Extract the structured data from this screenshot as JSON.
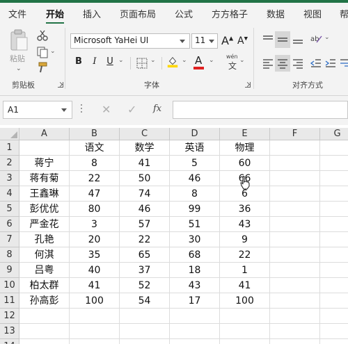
{
  "tabs": [
    "文件",
    "开始",
    "插入",
    "页面布局",
    "公式",
    "方方格子",
    "数据",
    "视图",
    "帮"
  ],
  "active_tab": "开始",
  "ribbon": {
    "paste_label": "粘贴",
    "clipboard_label": "剪贴板",
    "font_label": "字体",
    "align_label": "对齐方式",
    "font_name": "Microsoft YaHei UI",
    "font_size": "11",
    "bold": "B",
    "italic": "I",
    "underline": "U",
    "grow_font": "A",
    "shrink_font": "A",
    "wen_label": "wén",
    "wen_char": "文",
    "font_color": "#e02020",
    "fill_color": "#ffd800"
  },
  "formula_bar": {
    "cell_ref": "A1",
    "cancel": "✕",
    "confirm": "✓",
    "fx": "fx",
    "value": ""
  },
  "grid": {
    "columns": [
      "A",
      "B",
      "C",
      "D",
      "E",
      "F",
      "G"
    ],
    "rows": [
      "1",
      "2",
      "3",
      "4",
      "5",
      "6",
      "7",
      "8",
      "9",
      "10",
      "11",
      "12",
      "13",
      "14"
    ],
    "cells": [
      [
        "",
        "语文",
        "数学",
        "英语",
        "物理",
        "",
        ""
      ],
      [
        "蒋宁",
        "8",
        "41",
        "5",
        "60",
        "",
        ""
      ],
      [
        "蒋有菊",
        "22",
        "50",
        "46",
        "66",
        "",
        ""
      ],
      [
        "王鑫琳",
        "47",
        "74",
        "8",
        "6",
        "",
        ""
      ],
      [
        "彭优优",
        "80",
        "46",
        "99",
        "36",
        "",
        ""
      ],
      [
        "严金花",
        "3",
        "57",
        "51",
        "43",
        "",
        ""
      ],
      [
        "孔艳",
        "20",
        "22",
        "30",
        "9",
        "",
        ""
      ],
      [
        "何淇",
        "35",
        "65",
        "68",
        "22",
        "",
        ""
      ],
      [
        "吕粤",
        "40",
        "37",
        "18",
        "1",
        "",
        ""
      ],
      [
        "柏太群",
        "41",
        "52",
        "43",
        "41",
        "",
        ""
      ],
      [
        "孙高彭",
        "100",
        "54",
        "17",
        "100",
        "",
        ""
      ],
      [
        "",
        "",
        "",
        "",
        "",
        "",
        ""
      ],
      [
        "",
        "",
        "",
        "",
        "",
        "",
        ""
      ],
      [
        "",
        "",
        "",
        "",
        "",
        "",
        ""
      ]
    ]
  }
}
